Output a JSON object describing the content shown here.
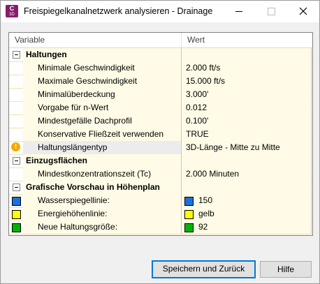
{
  "window": {
    "title": "Freispiegelkanalnetzwerk analysieren - Drainage",
    "app_icon_letter": "C",
    "app_icon_sub": "3D"
  },
  "grid": {
    "columns": {
      "variable": "Variable",
      "value": "Wert"
    },
    "categories": {
      "haltungen": "Haltungen",
      "einzugsflaechen": "Einzugsflächen",
      "grafische": "Grafische Vorschau in Höhenplan"
    },
    "rows": {
      "min_geschw": {
        "label": "Minimale Geschwindigkeit",
        "value": "2.000 ft/s"
      },
      "max_geschw": {
        "label": "Maximale Geschwindigkeit",
        "value": "15.000 ft/s"
      },
      "min_ueberdeckung": {
        "label": "Minimalüberdeckung",
        "value": "3.000'"
      },
      "n_wert": {
        "label": "Vorgabe für n-Wert",
        "value": "0.012"
      },
      "mindestgefaelle": {
        "label": "Mindestgefälle Dachprofil",
        "value": "0.100'"
      },
      "fliesszeit": {
        "label": "Konservative Fließzeit verwenden",
        "value": "TRUE"
      },
      "haltungslaenge": {
        "label": "Haltungslängentyp",
        "value": "3D-Länge - Mitte zu Mitte"
      },
      "konzentrationszeit": {
        "label": "Mindestkonzentrationszeit (Tc)",
        "value": "2.000 Minuten"
      },
      "wasserspiegel": {
        "label": "Wasserspiegellinie:",
        "value": "150",
        "color": "#1e6fd9"
      },
      "energiehoehe": {
        "label": "Energiehöhenlinie:",
        "value": "gelb",
        "color": "#ffff00"
      },
      "haltungsgroesse": {
        "label": "Neue Haltungsgröße:",
        "value": "92",
        "color": "#00b400"
      }
    }
  },
  "buttons": {
    "save": "Speichern und Zurück",
    "help": "Hilfe"
  }
}
